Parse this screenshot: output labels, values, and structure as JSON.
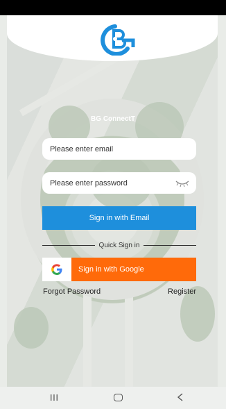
{
  "app": {
    "name": "BG ConnectT"
  },
  "login": {
    "email_placeholder": "Please enter email",
    "password_placeholder": "Please enter password",
    "sign_in_email_label": "Sign in with Email",
    "quick_sign_in_label": "Quick Sign in",
    "sign_in_google_label": "Sign in with Google",
    "forgot_password_label": "Forgot Password",
    "register_label": "Register"
  },
  "icons": {
    "logo": "bg-logo-icon",
    "eye": "eye-closed-icon",
    "google": "google-icon",
    "nav_recent": "recent-apps-icon",
    "nav_home": "home-icon",
    "nav_back": "back-icon"
  },
  "colors": {
    "brand_blue": "#1e8fdc",
    "google_orange": "#ff6a0a",
    "status_bar": "#000000"
  }
}
